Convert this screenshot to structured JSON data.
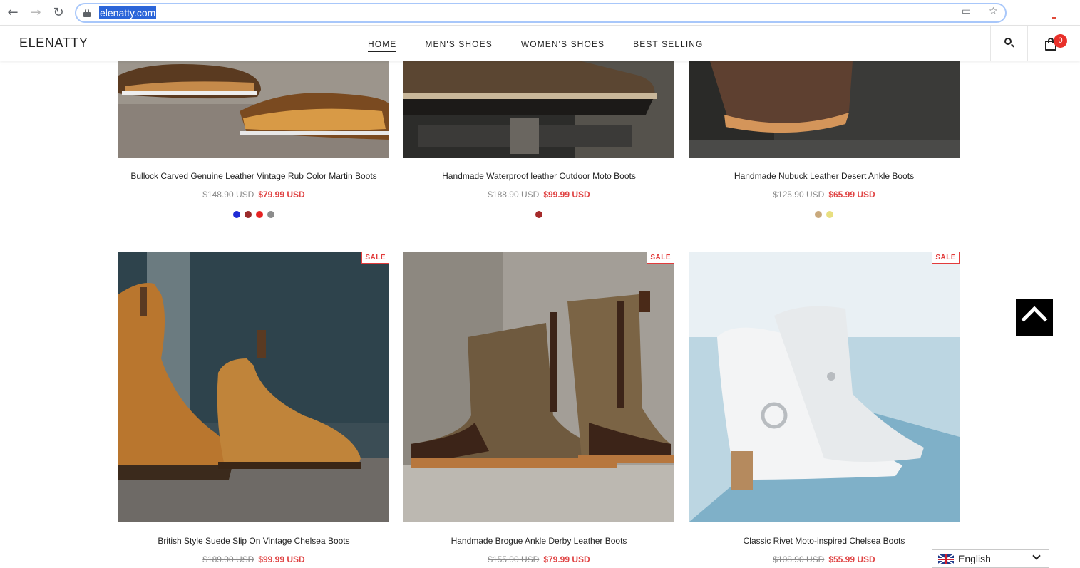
{
  "browser": {
    "url": "elenatty.com"
  },
  "header": {
    "logo": "ELENATTY",
    "menu": [
      {
        "label": "HOME",
        "active": true
      },
      {
        "label": "MEN'S SHOES",
        "active": false
      },
      {
        "label": "WOMEN'S SHOES",
        "active": false
      },
      {
        "label": "BEST SELLING",
        "active": false
      }
    ],
    "cart_count": "0"
  },
  "products": [
    {
      "title": "Bullock Carved Genuine Leather Vintage Rub Color Martin Boots",
      "old_price": "$148.90 USD",
      "new_price": "$79.99 USD",
      "swatches": [
        "#1f2bd6",
        "#9b2a2a",
        "#e62222",
        "#8c8c8c"
      ]
    },
    {
      "title": "Handmade Waterproof leather Outdoor Moto Boots",
      "old_price": "$188.90 USD",
      "new_price": "$99.99 USD",
      "swatches": [
        "#a52a2a"
      ]
    },
    {
      "title": "Handmade Nubuck Leather Desert Ankle Boots",
      "old_price": "$125.90 USD",
      "new_price": "$65.99 USD",
      "swatches": [
        "#c9a97c",
        "#e8df80"
      ]
    },
    {
      "badge": "SALE",
      "title": "British Style Suede Slip On Vintage Chelsea Boots",
      "old_price": "$189.90 USD",
      "new_price": "$99.99 USD"
    },
    {
      "badge": "SALE",
      "title": "Handmade Brogue Ankle Derby Leather Boots",
      "old_price": "$155.90 USD",
      "new_price": "$79.99 USD"
    },
    {
      "badge": "SALE",
      "title": "Classic Rivet Moto-inspired Chelsea Boots",
      "old_price": "$108.90 USD",
      "new_price": "$55.99 USD"
    }
  ],
  "language": {
    "label": "English"
  }
}
